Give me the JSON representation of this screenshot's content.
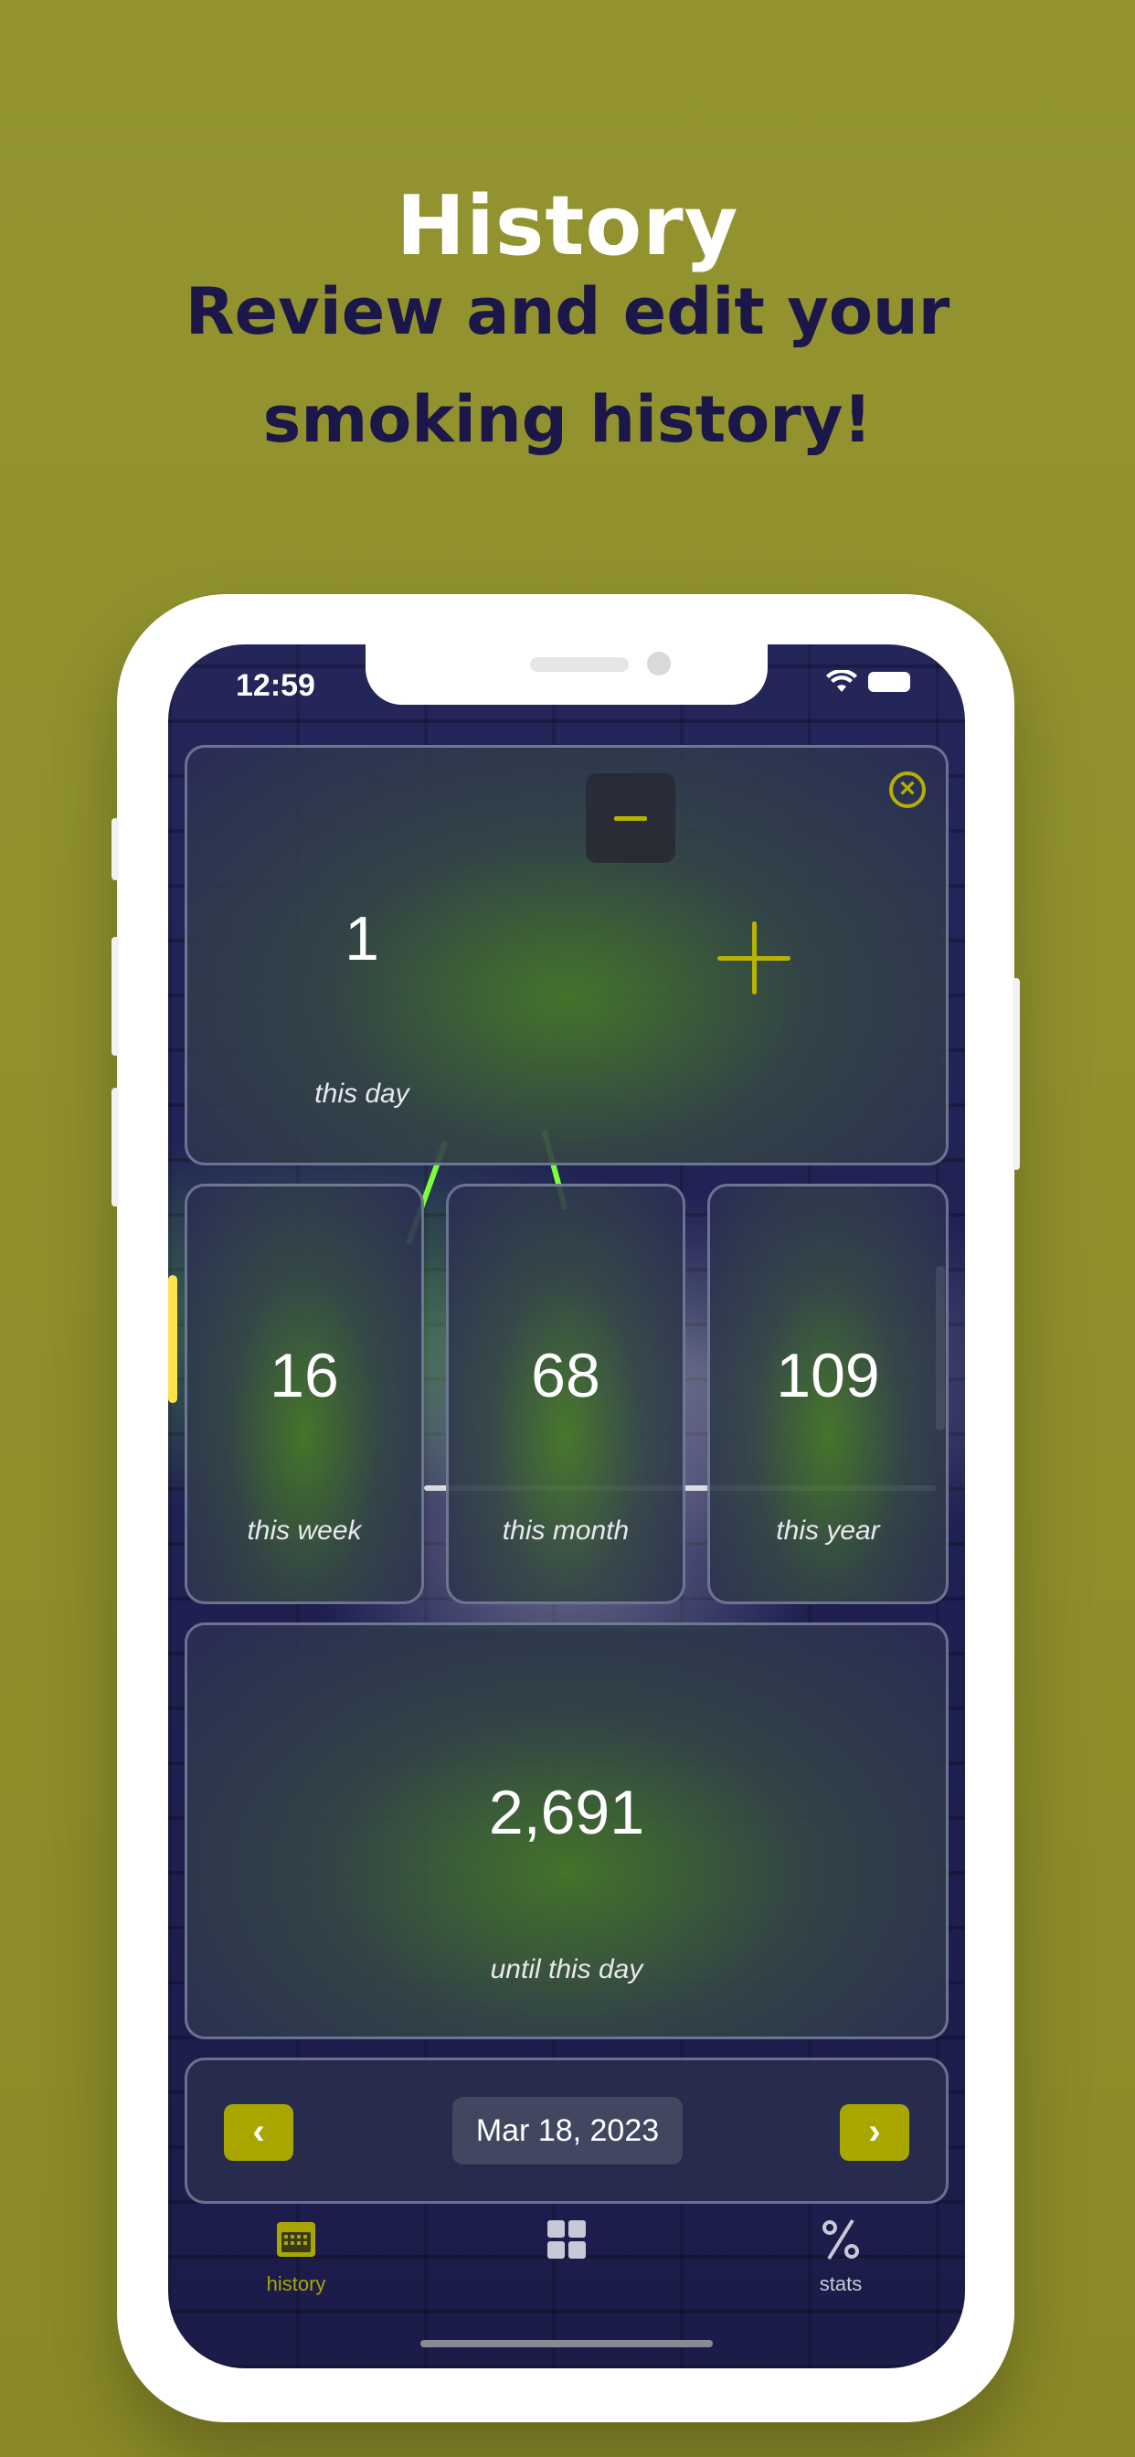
{
  "promo": {
    "title": "History",
    "subtitle_line1": "Review and edit your",
    "subtitle_line2": "smoking history!"
  },
  "status_bar": {
    "time": "12:59"
  },
  "day_card": {
    "value": "1",
    "label": "this day"
  },
  "stats": [
    {
      "value": "16",
      "label": "this week"
    },
    {
      "value": "68",
      "label": "this month"
    },
    {
      "value": "109",
      "label": "this year"
    }
  ],
  "total_card": {
    "value": "2,691",
    "label": "until this day"
  },
  "date_nav": {
    "date": "Mar 18, 2023",
    "prev": "‹",
    "next": "›"
  },
  "tabs": [
    {
      "label": "history",
      "icon": "calendar-icon",
      "active": true
    },
    {
      "label": "",
      "icon": "grid-icon",
      "active": false
    },
    {
      "label": "stats",
      "icon": "percent-icon",
      "active": false
    }
  ],
  "colors": {
    "background": "#939430",
    "title": "#ffffff",
    "subtitle": "#1b1748",
    "accent": "#a9a600",
    "screen_bg": "#1f2050"
  }
}
